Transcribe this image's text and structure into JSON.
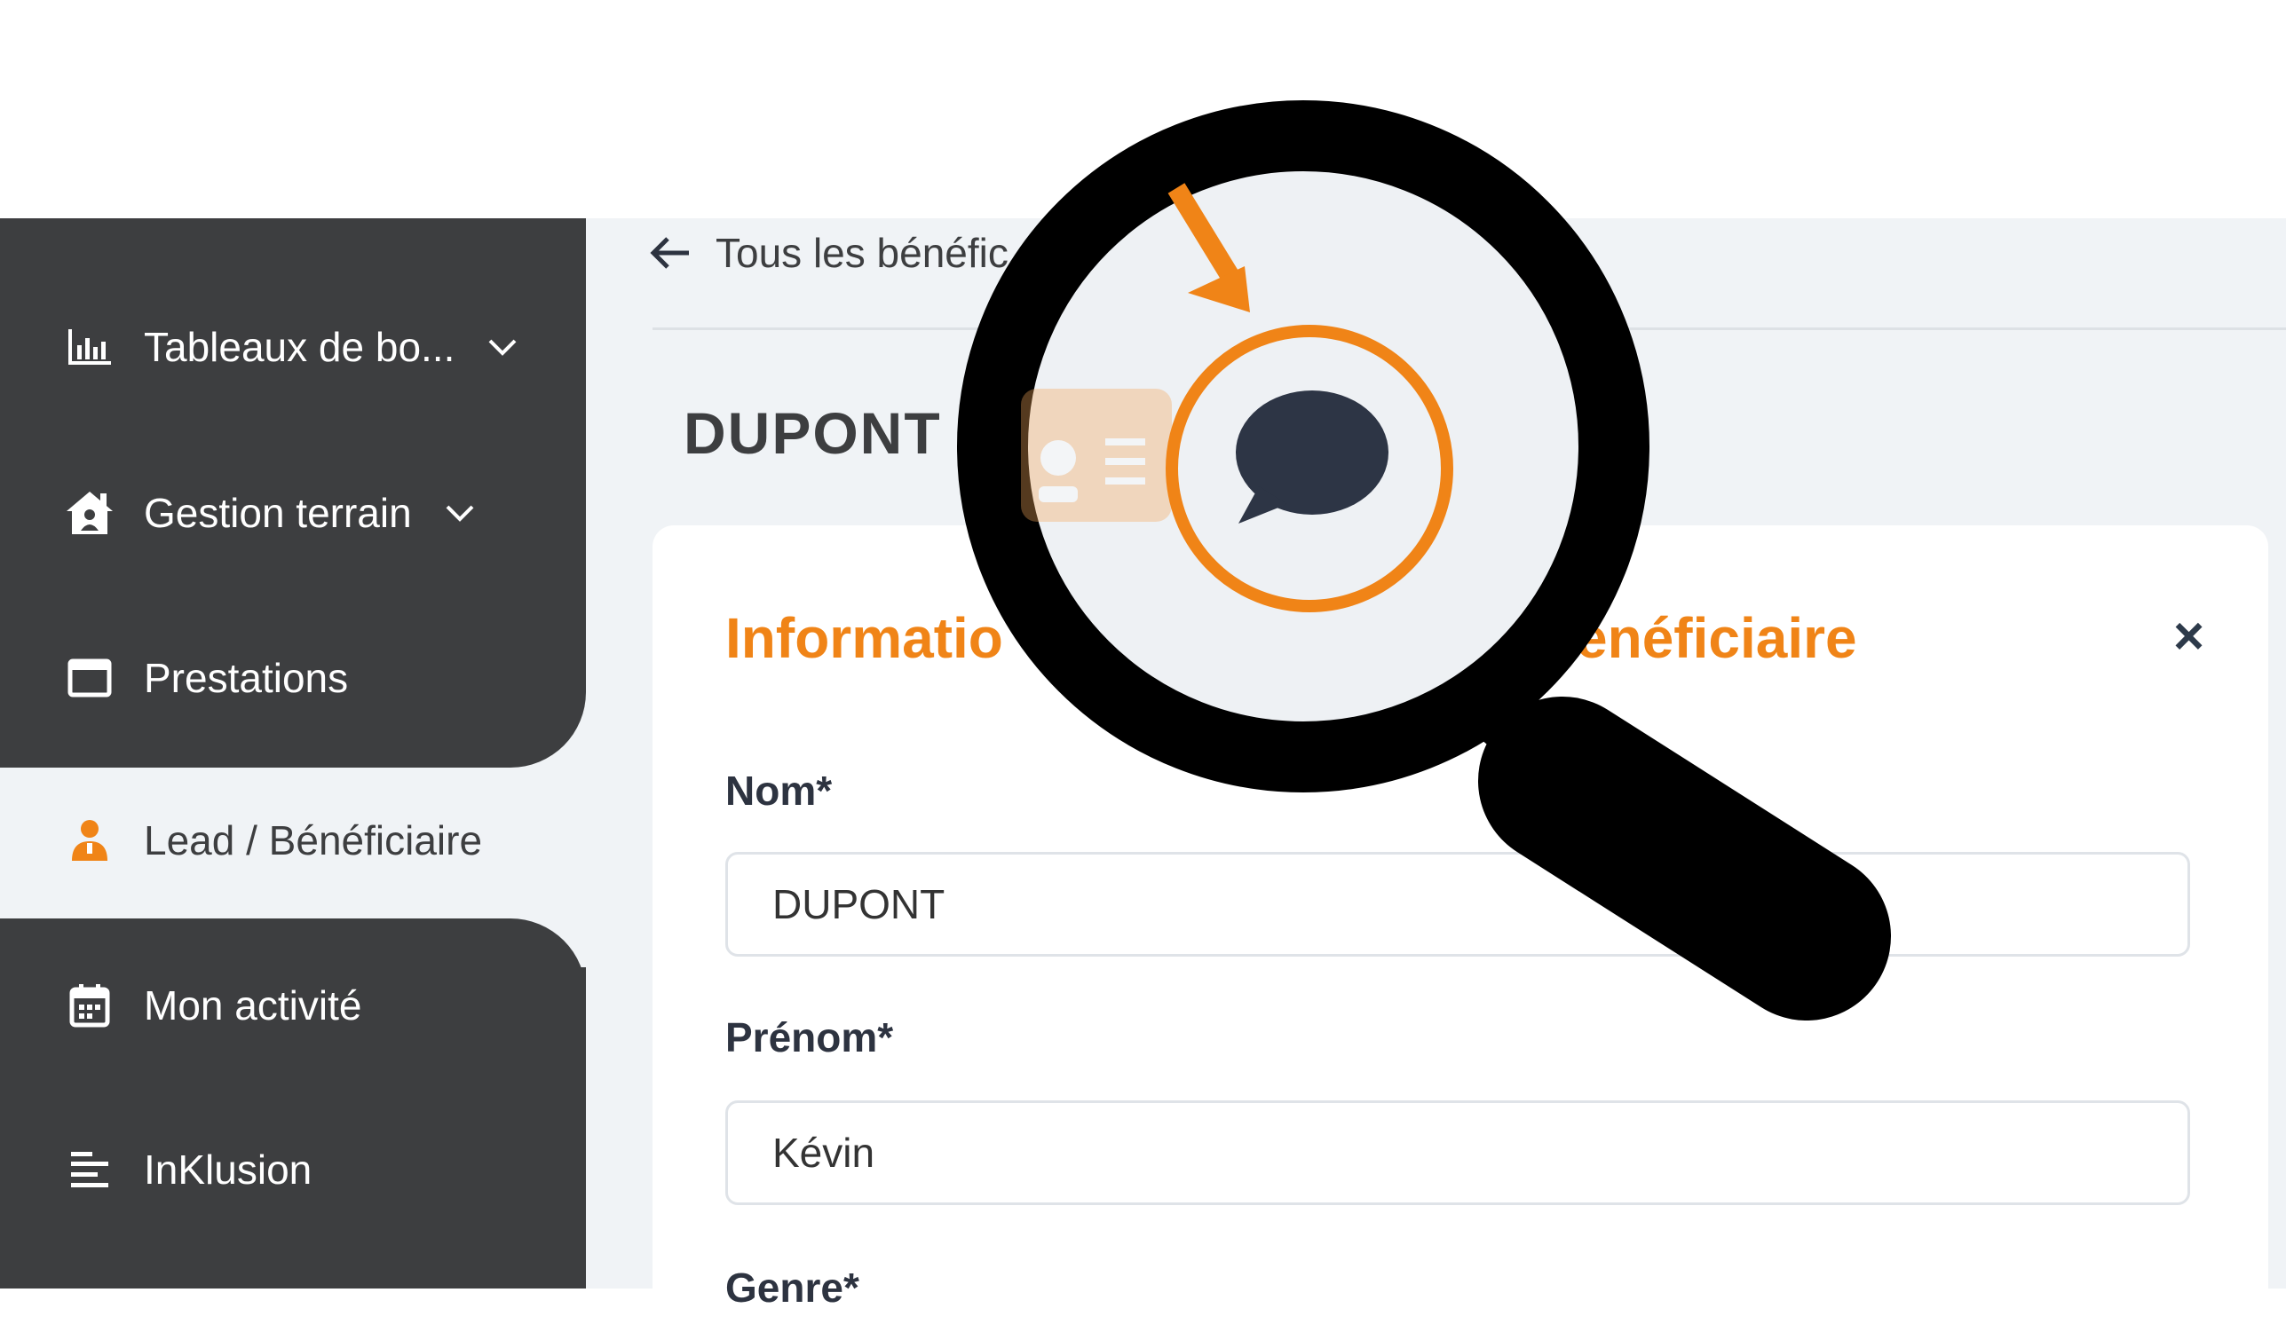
{
  "sidebar": {
    "items": [
      {
        "label": "Tableaux de bo...",
        "icon": "bar-chart-icon",
        "has_chevron": true
      },
      {
        "label": "Gestion terrain",
        "icon": "house-user-icon",
        "has_chevron": true
      },
      {
        "label": "Prestations",
        "icon": "window-icon",
        "has_chevron": false
      },
      {
        "label": "Lead / Bénéficiaire",
        "icon": "person-icon",
        "has_chevron": false,
        "active": true
      },
      {
        "label": "Mon activité",
        "icon": "calendar-icon",
        "has_chevron": false
      },
      {
        "label": "InKlusion",
        "icon": "align-left-icon",
        "has_chevron": false
      }
    ]
  },
  "header": {
    "back_label": "Tous les bénéfic",
    "page_title": "DUPONT"
  },
  "card": {
    "title_left": "Informatio",
    "title_right": "énéficiaire",
    "close": "×",
    "fields": [
      {
        "label": "Nom*",
        "value": "DUPONT"
      },
      {
        "label": "Prénom*",
        "value": "Kévin"
      },
      {
        "label": "Genre*"
      }
    ]
  },
  "colors": {
    "accent": "#f08417",
    "sidebar": "#3d3e40",
    "background": "#f0f3f6",
    "chat_bubble": "#2d3545"
  },
  "overlay": {
    "magnifier_icon": "magnifying-glass-icon",
    "focus_icon": "chat-bubble-icon",
    "id_card_icon": "id-card-icon",
    "arrow_icon": "arrow-down-icon"
  }
}
